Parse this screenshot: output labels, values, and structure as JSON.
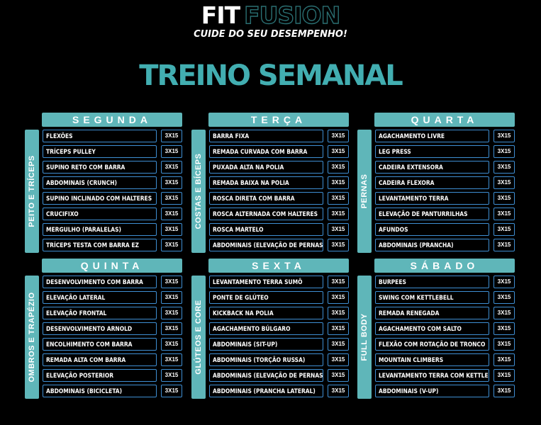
{
  "brand": {
    "fit": "FIT",
    "fusion": "FUSION",
    "tagline": "CUIDE DO SEU DESEMPENHO!"
  },
  "title": "TREINO SEMANAL",
  "colors": {
    "accent": "#5fb6b9",
    "title": "#42aeb1",
    "border": "#3f8fd3",
    "background": "#000000"
  },
  "days": [
    {
      "name": "SEGUNDA",
      "group": "PEITO E TRÍCEPS",
      "exercises": [
        {
          "name": "FLEXÕES",
          "sets": "3X15"
        },
        {
          "name": "TRÍCEPS PULLEY",
          "sets": "3X15"
        },
        {
          "name": "SUPINO RETO COM BARRA",
          "sets": "3X15"
        },
        {
          "name": "ABDOMINAIS (CRUNCH)",
          "sets": "3X15"
        },
        {
          "name": "SUPINO INCLINADO COM HALTERES",
          "sets": "3X15"
        },
        {
          "name": "CRUCIFIXO",
          "sets": "3X15"
        },
        {
          "name": "MERGULHO (PARALELAS)",
          "sets": "3X15"
        },
        {
          "name": "TRÍCEPS TESTA COM BARRA EZ",
          "sets": "3X15"
        }
      ]
    },
    {
      "name": "TERÇA",
      "group": "COSTAS E BÍCEPS",
      "exercises": [
        {
          "name": "BARRA FIXA",
          "sets": "3X15"
        },
        {
          "name": "REMADA CURVADA COM BARRA",
          "sets": "3X15"
        },
        {
          "name": "PUXADA ALTA NA POLIA",
          "sets": "3X15"
        },
        {
          "name": "REMADA BAIXA NA POLIA",
          "sets": "3X15"
        },
        {
          "name": "ROSCA DIRETA COM BARRA",
          "sets": "3X15"
        },
        {
          "name": "ROSCA ALTERNADA COM HALTERES",
          "sets": "3X15"
        },
        {
          "name": "ROSCA MARTELO",
          "sets": "3X15"
        },
        {
          "name": "ABDOMINAIS (ELEVAÇÃO DE PERNAS)",
          "sets": "3X15"
        }
      ]
    },
    {
      "name": "QUARTA",
      "group": "PERNAS",
      "exercises": [
        {
          "name": "AGACHAMENTO LIVRE",
          "sets": "3X15"
        },
        {
          "name": "LEG PRESS",
          "sets": "3X15"
        },
        {
          "name": "CADEIRA EXTENSORA",
          "sets": "3X15"
        },
        {
          "name": "CADEIRA FLEXORA",
          "sets": "3X15"
        },
        {
          "name": "LEVANTAMENTO TERRA",
          "sets": "3X15"
        },
        {
          "name": "ELEVAÇÃO DE PANTURRILHAS",
          "sets": "3X15"
        },
        {
          "name": "AFUNDOS",
          "sets": "3X15"
        },
        {
          "name": "ABDOMINAIS (PRANCHA)",
          "sets": "3X15"
        }
      ]
    },
    {
      "name": "QUINTA",
      "group": "OMBROS E TRAPÉZIO",
      "exercises": [
        {
          "name": "DESENVOLVIMENTO COM BARRA",
          "sets": "3X15"
        },
        {
          "name": "ELEVAÇÃO LATERAL",
          "sets": "3X15"
        },
        {
          "name": "ELEVAÇÃO FRONTAL",
          "sets": "3X15"
        },
        {
          "name": "DESENVOLVIMENTO ARNOLD",
          "sets": "3X15"
        },
        {
          "name": "ENCOLHIMENTO COM BARRA",
          "sets": "3X15"
        },
        {
          "name": "REMADA ALTA COM BARRA",
          "sets": "3X15"
        },
        {
          "name": "ELEVAÇÃO POSTERIOR",
          "sets": "3X15"
        },
        {
          "name": "ABDOMINAIS (BICICLETA)",
          "sets": "3X15"
        }
      ]
    },
    {
      "name": "SEXTA",
      "group": "GLÚTEOS E CORE",
      "exercises": [
        {
          "name": "LEVANTAMENTO TERRA SUMÔ",
          "sets": "3X15"
        },
        {
          "name": "PONTE DE GLÚTEO",
          "sets": "3X15"
        },
        {
          "name": "KICKBACK NA POLIA",
          "sets": "3X15"
        },
        {
          "name": "AGACHAMENTO BÚLGARO",
          "sets": "3X15"
        },
        {
          "name": "ABDOMINAIS (SIT-UP)",
          "sets": "3X15"
        },
        {
          "name": "ABDOMINAIS (TORÇÃO RUSSA)",
          "sets": "3X15"
        },
        {
          "name": "ABDOMINAIS (ELEVAÇÃO DE PERNAS)",
          "sets": "3X15"
        },
        {
          "name": "ABDOMINAIS (PRANCHA LATERAL)",
          "sets": "3X15"
        }
      ]
    },
    {
      "name": "SÁBADO",
      "group": "FULL BODY",
      "exercises": [
        {
          "name": "BURPEES",
          "sets": "3X15"
        },
        {
          "name": "SWING COM KETTLEBELL",
          "sets": "3X15"
        },
        {
          "name": "REMADA RENEGADA",
          "sets": "3X15"
        },
        {
          "name": "AGACHAMENTO COM SALTO",
          "sets": "3X15"
        },
        {
          "name": "FLEXÃO COM ROTAÇÃO DE TRONCO",
          "sets": "3X15"
        },
        {
          "name": "MOUNTAIN CLIMBERS",
          "sets": "3X15"
        },
        {
          "name": "LEVANTAMENTO TERRA COM KETTLEBELL",
          "sets": "3X15"
        },
        {
          "name": "ABDOMINAIS (V-UP)",
          "sets": "3X15"
        }
      ]
    }
  ]
}
